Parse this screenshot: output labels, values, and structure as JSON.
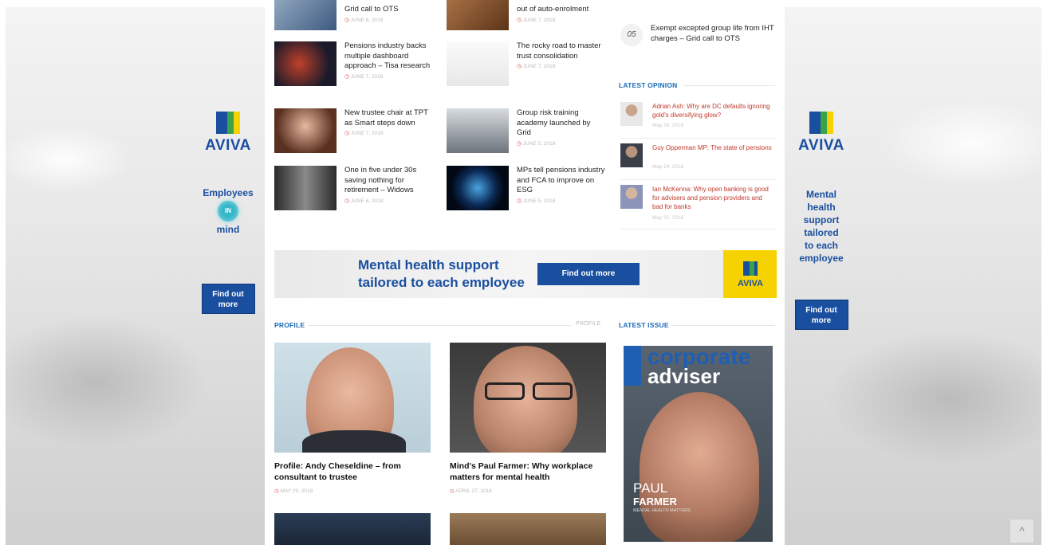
{
  "left_ad": {
    "brand": "AVIVA",
    "tagline_top": "Employees",
    "badge": "IN",
    "tagline_bottom": "mind",
    "button": "Find out more"
  },
  "right_ad": {
    "brand": "AVIVA",
    "text_lines": [
      "Mental",
      "health",
      "support",
      "tailored",
      "to each",
      "employee"
    ],
    "button": "Find out more"
  },
  "news": [
    {
      "title": "Grid call to OTS",
      "date": "JUNE 8, 2018"
    },
    {
      "title": "out of auto-enrolment",
      "date": "JUNE 7, 2018"
    },
    {
      "title": "Pensions industry backs multiple dashboard approach – Tisa research",
      "date": "JUNE 7, 2018"
    },
    {
      "title": "The rocky road to master trust consolidation",
      "date": "JUNE 7, 2018"
    },
    {
      "title": "New trustee chair at TPT as Smart steps down",
      "date": "JUNE 7, 2018"
    },
    {
      "title": "Group risk training academy launched by Grid",
      "date": "JUNE 5, 2018"
    },
    {
      "title": "One in five under 30s saving nothing for retirement – Widows",
      "date": "JUNE 6, 2018"
    },
    {
      "title": "MPs tell pensions industry and FCA to improve on ESG",
      "date": "JUNE 5, 2018"
    }
  ],
  "trending": {
    "num": "05",
    "title": "Exempt excepted group life from IHT charges – Grid call to OTS"
  },
  "latest_opinion": {
    "label": "LATEST OPINION",
    "items": [
      {
        "title": "Adrian Ash: Why are DC defaults ignoring gold's diversifying glow?",
        "date": "May 29, 2018"
      },
      {
        "title": "Guy Opperman MP: The state of pensions",
        "date": "May 24, 2018"
      },
      {
        "title": "Ian McKenna: Why open banking is good for advisers and pension providers and bad for banks",
        "date": "May 21, 2018"
      }
    ]
  },
  "banner": {
    "line1": "Mental health support",
    "line2": "tailored to each employee",
    "button": "Find out more",
    "brand": "AVIVA"
  },
  "profile_section": {
    "label": "PROFILE",
    "right_label": "PROFILE"
  },
  "profiles": [
    {
      "title": "Profile: Andy Cheseldine – from consultant to trustee",
      "date": "MAY 29, 2018"
    },
    {
      "title": "Mind's Paul Farmer: Why workplace matters for mental health",
      "date": "APRIL 27, 2018"
    }
  ],
  "latest_issue": {
    "label": "LATEST ISSUE",
    "mag_top": "corporate",
    "mag_bottom": "adviser",
    "name_line1": "PAUL",
    "name_line2": "FARMER",
    "subtitle": "MENTAL HEALTH MATTERS"
  },
  "scroll_top": "^"
}
